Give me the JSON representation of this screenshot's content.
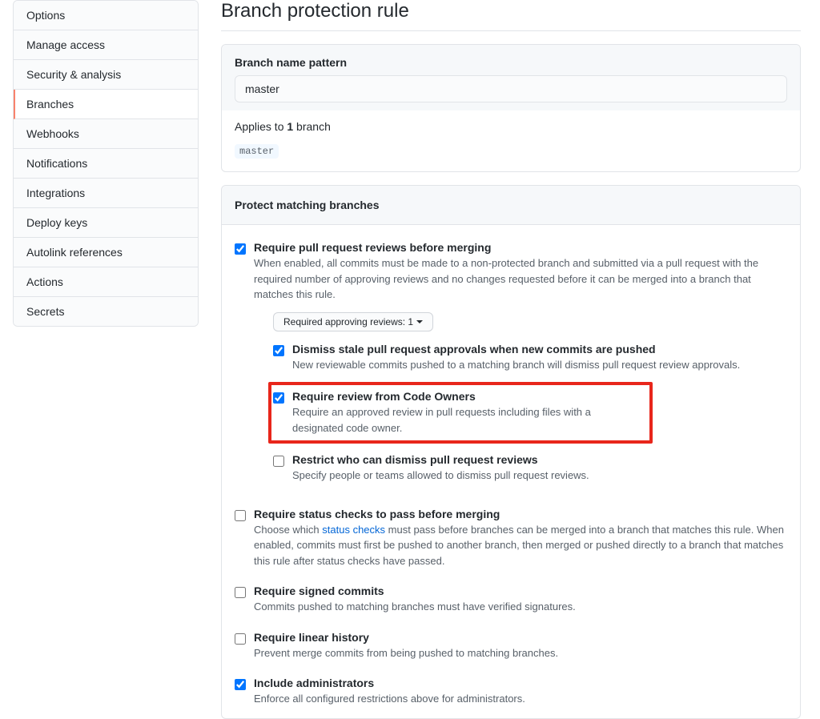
{
  "sidebar": {
    "items": [
      {
        "label": "Options"
      },
      {
        "label": "Manage access"
      },
      {
        "label": "Security & analysis"
      },
      {
        "label": "Branches"
      },
      {
        "label": "Webhooks"
      },
      {
        "label": "Notifications"
      },
      {
        "label": "Integrations"
      },
      {
        "label": "Deploy keys"
      },
      {
        "label": "Autolink references"
      },
      {
        "label": "Actions"
      },
      {
        "label": "Secrets"
      }
    ],
    "active_index": 3
  },
  "page_title": "Branch protection rule",
  "pattern_panel": {
    "label": "Branch name pattern",
    "value": "master",
    "applies_prefix": "Applies to ",
    "applies_count": "1",
    "applies_suffix": " branch",
    "chip": "master"
  },
  "protect_heading": "Protect matching branches",
  "rules": {
    "require_pr": {
      "title": "Require pull request reviews before merging",
      "desc": "When enabled, all commits must be made to a non-protected branch and submitted via a pull request with the required number of approving reviews and no changes requested before it can be merged into a branch that matches this rule.",
      "select_label": "Required approving reviews: 1"
    },
    "dismiss_stale": {
      "title": "Dismiss stale pull request approvals when new commits are pushed",
      "desc": "New reviewable commits pushed to a matching branch will dismiss pull request review approvals."
    },
    "code_owners": {
      "title": "Require review from Code Owners",
      "desc": "Require an approved review in pull requests including files with a designated code owner."
    },
    "restrict_dismiss": {
      "title": "Restrict who can dismiss pull request reviews",
      "desc": "Specify people or teams allowed to dismiss pull request reviews."
    },
    "status_checks": {
      "title": "Require status checks to pass before merging",
      "desc_prefix": "Choose which ",
      "desc_link": "status checks",
      "desc_suffix": " must pass before branches can be merged into a branch that matches this rule. When enabled, commits must first be pushed to another branch, then merged or pushed directly to a branch that matches this rule after status checks have passed."
    },
    "signed_commits": {
      "title": "Require signed commits",
      "desc": "Commits pushed to matching branches must have verified signatures."
    },
    "linear_history": {
      "title": "Require linear history",
      "desc": "Prevent merge commits from being pushed to matching branches."
    },
    "include_admins": {
      "title": "Include administrators",
      "desc": "Enforce all configured restrictions above for administrators."
    }
  }
}
